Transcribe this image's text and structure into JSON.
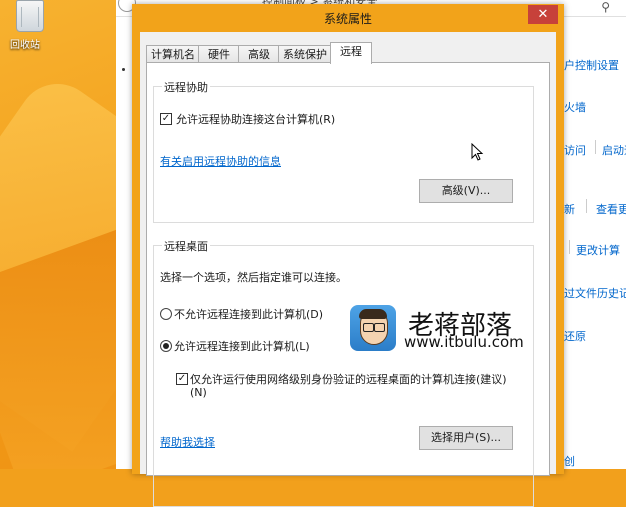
{
  "desktop": {
    "recycle_bin_label": "回收站"
  },
  "background_window": {
    "address_text": "控制面板 > 系统和安全",
    "links": [
      "户控制设置",
      "火墙",
      "访问",
      "启动远",
      "新",
      "查看更",
      "更改计算",
      "过文件历史记",
      "还原",
      "创"
    ]
  },
  "dialog": {
    "title": "系统属性",
    "close_glyph": "✕",
    "tabs": [
      "计算机名",
      "硬件",
      "高级",
      "系统保护",
      "远程"
    ],
    "active_tab": "远程",
    "remote_assistance": {
      "group_title": "远程协助",
      "allow_checkbox_label": "允许远程协助连接这台计算机(R)",
      "allow_checked": true,
      "info_link": "有关启用远程协助的信息",
      "advanced_button": "高级(V)..."
    },
    "remote_desktop": {
      "group_title": "远程桌面",
      "instruction": "选择一个选项，然后指定谁可以连接。",
      "option_deny": "不允许远程连接到此计算机(D)",
      "option_allow": "允许远程连接到此计算机(L)",
      "selected_option": "allow",
      "nla_checkbox_label": "仅允许运行使用网络级别身份验证的远程桌面的计算机连接(建议)",
      "nla_checkbox_label_line2": "(N)",
      "nla_checked": true,
      "help_link": "帮助我选择",
      "select_users_button": "选择用户(S)..."
    }
  },
  "watermark": {
    "title": "老蒋部落",
    "url": "www.itbulu.com"
  },
  "colors": {
    "desktop": "#f2a01c",
    "dialog_frame": "#f2a31a",
    "close_button": "#c7413a",
    "link": "#0066cc"
  }
}
